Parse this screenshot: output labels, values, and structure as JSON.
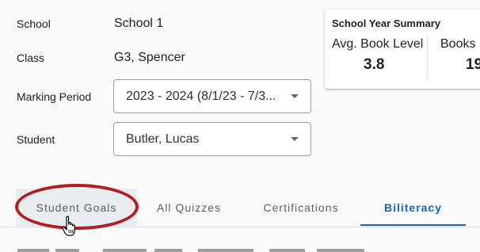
{
  "form": {
    "school": {
      "label": "School",
      "value": "School 1"
    },
    "class": {
      "label": "Class",
      "value": "G3, Spencer"
    },
    "marking_period": {
      "label": "Marking Period",
      "value": "2023 - 2024 (8/1/23 - 7/3..."
    },
    "student": {
      "label": "Student",
      "value": "Butler, Lucas"
    }
  },
  "summary": {
    "title": "School Year Summary",
    "stats": [
      {
        "label": "Avg. Book Level",
        "value": "3.8"
      },
      {
        "label": "Books",
        "value": "19"
      }
    ]
  },
  "tabs": [
    {
      "label": "Student Goals"
    },
    {
      "label": "All Quizzes"
    },
    {
      "label": "Certifications"
    },
    {
      "label": "Biliteracy"
    }
  ],
  "colors": {
    "accent": "#1565c0",
    "highlight": "#b71c1c"
  }
}
